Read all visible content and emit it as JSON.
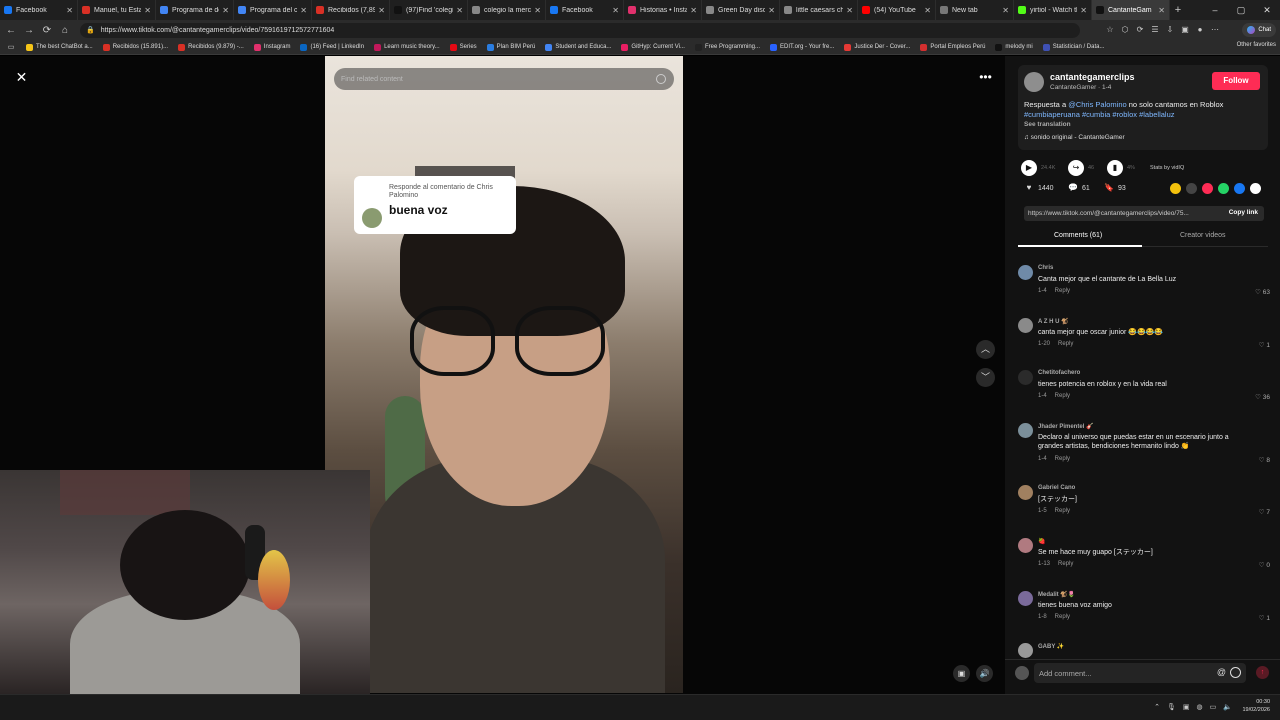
{
  "browser": {
    "tabs": [
      {
        "label": "Facebook",
        "color": "#1877f2"
      },
      {
        "label": "Manuel, tu Estado",
        "color": "#d93025"
      },
      {
        "label": "Programa de desa",
        "color": "#4285f4"
      },
      {
        "label": "Programa del curs",
        "color": "#4285f4"
      },
      {
        "label": "Recibidos (7,898)",
        "color": "#d93025"
      },
      {
        "label": "(97)Find 'colegio l",
        "color": "#111111"
      },
      {
        "label": "colegio la merced",
        "color": "#888888"
      },
      {
        "label": "Facebook",
        "color": "#1877f2"
      },
      {
        "label": "Historias • Instagr",
        "color": "#e1306c"
      },
      {
        "label": "Green Day discogr",
        "color": "#888888"
      },
      {
        "label": "little caesars chim",
        "color": "#888888"
      },
      {
        "label": "(54) YouTube",
        "color": "#ff0000"
      },
      {
        "label": "New tab",
        "color": "#777777"
      },
      {
        "label": "yirtiol - Watch the",
        "color": "#53fc18"
      },
      {
        "label": "CantanteGam",
        "color": "#111111",
        "active": true
      }
    ],
    "new_tab": "+",
    "url": "https://www.tiktok.com/@cantantegamerclips/video/7591619712572771604",
    "copilot": "Chat",
    "bookmarks": [
      {
        "label": "The best ChatBot a...",
        "color": "#f5c518"
      },
      {
        "label": "Recibidos (15.891)...",
        "color": "#d93025"
      },
      {
        "label": "Recibidos (9.879) -...",
        "color": "#d93025"
      },
      {
        "label": "Instagram",
        "color": "#e1306c"
      },
      {
        "label": "(16) Feed | LinkedIn",
        "color": "#0a66c2"
      },
      {
        "label": "Learn music theory...",
        "color": "#c2185b"
      },
      {
        "label": "Series",
        "color": "#e50914"
      },
      {
        "label": "Plan BIM Perú",
        "color": "#2a7de1"
      },
      {
        "label": "Student and Educa...",
        "color": "#4285f4"
      },
      {
        "label": "GitHyp: Current Vi...",
        "color": "#e91e63"
      },
      {
        "label": "Free Programming...",
        "color": "#222222"
      },
      {
        "label": "EDIT.org - Your fre...",
        "color": "#2962ff"
      },
      {
        "label": "Justice Der - Cover...",
        "color": "#e53935"
      },
      {
        "label": "Portal Empleos Perú",
        "color": "#d32f2f"
      },
      {
        "label": "melody mi",
        "color": "#111111"
      },
      {
        "label": "Statistician / Data...",
        "color": "#3f51b5"
      }
    ],
    "other_favorites": "Other favorites"
  },
  "video": {
    "search_placeholder": "Find related content",
    "reply_card": {
      "label": "Responde al comentario de Chris Palomino",
      "text": "buena voz"
    }
  },
  "sidebar": {
    "author": {
      "name": "cantantegamerclips",
      "sub": "CantanteGamer · 1-4",
      "follow": "Follow"
    },
    "description": {
      "prefix": "Respuesta a ",
      "mention": "@Chris Palomino",
      "text": " no solo cantamos en Roblox ",
      "hashtags": "#cumbiaperuana #cumbia #roblox #labellaluz",
      "see_translation": "See translation"
    },
    "sound": "♫  sonido original - CantanteGamer",
    "controls": {
      "play_count": "24.4K",
      "share_count": "46",
      "stats_pct": "4%",
      "stats_label": "Stats by vidIQ"
    },
    "metrics": {
      "likes": "1440",
      "comments": "61",
      "saves": "93"
    },
    "share_colors": [
      "#f4c20d",
      "#444444",
      "#fe2c55",
      "#25d366",
      "#1877f2",
      "#ffffff"
    ],
    "link": "https://www.tiktok.com/@cantantegamerclips/video/75...",
    "copy_link": "Copy link",
    "tabs": {
      "comments": "Comments (61)",
      "creator": "Creator videos"
    },
    "comments": [
      {
        "name": "Chris",
        "text": "Canta mejor que el cantante de La Bella Luz",
        "date": "1-4",
        "likes": "63",
        "reply": "Reply"
      },
      {
        "name": "A Z H U 🐒",
        "text": "canta mejor que oscar junior 😂😂😂😂",
        "date": "1-20",
        "likes": "1",
        "reply": "Reply"
      },
      {
        "name": "Chetitofachero",
        "text": "tienes potencia en roblox y en la vida real",
        "date": "1-4",
        "likes": "36",
        "reply": "Reply"
      },
      {
        "name": "Jhader Pimentel 🎸",
        "text": "Declaro al universo que puedas estar en un escenario junto a grandes artistas, bendiciones hermanito lindo 👏",
        "date": "1-4",
        "likes": "8",
        "reply": "Reply"
      },
      {
        "name": "Gabriel Cano",
        "text": "[ステッカー]",
        "date": "1-5",
        "likes": "7",
        "reply": "Reply"
      },
      {
        "name": "🍓",
        "text": "Se me hace muy guapo [ステッカー]",
        "date": "1-13",
        "likes": "0",
        "reply": "Reply"
      },
      {
        "name": "Medalit 🐒🌷",
        "text": "tienes buena voz amigo",
        "date": "1-8",
        "likes": "1",
        "reply": "Reply"
      },
      {
        "name": "GABY ✨",
        "text": "",
        "date": "",
        "likes": "",
        "reply": ""
      }
    ],
    "add_comment": "Add comment...",
    "at": "@"
  },
  "taskbar": {
    "time": "00:30",
    "date": "19/02/2026"
  },
  "accent": "#fe2c55"
}
